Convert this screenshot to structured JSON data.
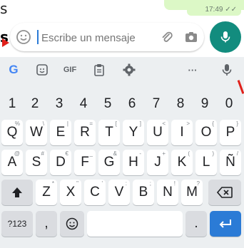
{
  "left_fragments": {
    "top": "s",
    "mid": "s",
    "num_row": "3,"
  },
  "chat": {
    "time": "17:49 ✓✓"
  },
  "composer": {
    "placeholder": "Escribe un mensaje"
  },
  "toolbar": {
    "gif_label": "GIF",
    "more_label": "···"
  },
  "number_row": [
    "1",
    "2",
    "3",
    "4",
    "5",
    "6",
    "7",
    "8",
    "9",
    "0"
  ],
  "row1": [
    {
      "k": "Q",
      "alt": "%"
    },
    {
      "k": "W",
      "alt": "\\"
    },
    {
      "k": "E",
      "alt": "|"
    },
    {
      "k": "R",
      "alt": "="
    },
    {
      "k": "T",
      "alt": "["
    },
    {
      "k": "Y",
      "alt": "]"
    },
    {
      "k": "U",
      "alt": "<"
    },
    {
      "k": "I",
      "alt": ">"
    },
    {
      "k": "O",
      "alt": "{"
    },
    {
      "k": "P",
      "alt": "}"
    }
  ],
  "row2": [
    {
      "k": "A",
      "alt": "@"
    },
    {
      "k": "S",
      "alt": "#"
    },
    {
      "k": "D",
      "alt": "€"
    },
    {
      "k": "F",
      "alt": "_"
    },
    {
      "k": "G",
      "alt": "&"
    },
    {
      "k": "H",
      "alt": "-"
    },
    {
      "k": "J",
      "alt": "+"
    },
    {
      "k": "K",
      "alt": "("
    },
    {
      "k": "L",
      "alt": ")"
    },
    {
      "k": "Ñ",
      "alt": "/"
    }
  ],
  "row3": [
    {
      "k": "Z",
      "alt": "*"
    },
    {
      "k": "X",
      "alt": "\""
    },
    {
      "k": "C",
      "alt": "'"
    },
    {
      "k": "V",
      "alt": ":"
    },
    {
      "k": "B",
      "alt": ";"
    },
    {
      "k": "N",
      "alt": "!"
    },
    {
      "k": "M",
      "alt": "?"
    }
  ],
  "bottom_row": {
    "symbols_label": "?123",
    "comma_label": ",",
    "period_label": "."
  },
  "colors": {
    "accent_green": "#128c7e",
    "enter_blue": "#2b7bd6",
    "keyboard_bg": "#eceff1"
  },
  "icons": [
    "emoji-icon",
    "paperclip-icon",
    "camera-icon",
    "mic-icon",
    "google-g-icon",
    "sticker-icon",
    "clipboard-icon",
    "gear-icon",
    "shift-icon",
    "backspace-icon",
    "enter-icon"
  ]
}
